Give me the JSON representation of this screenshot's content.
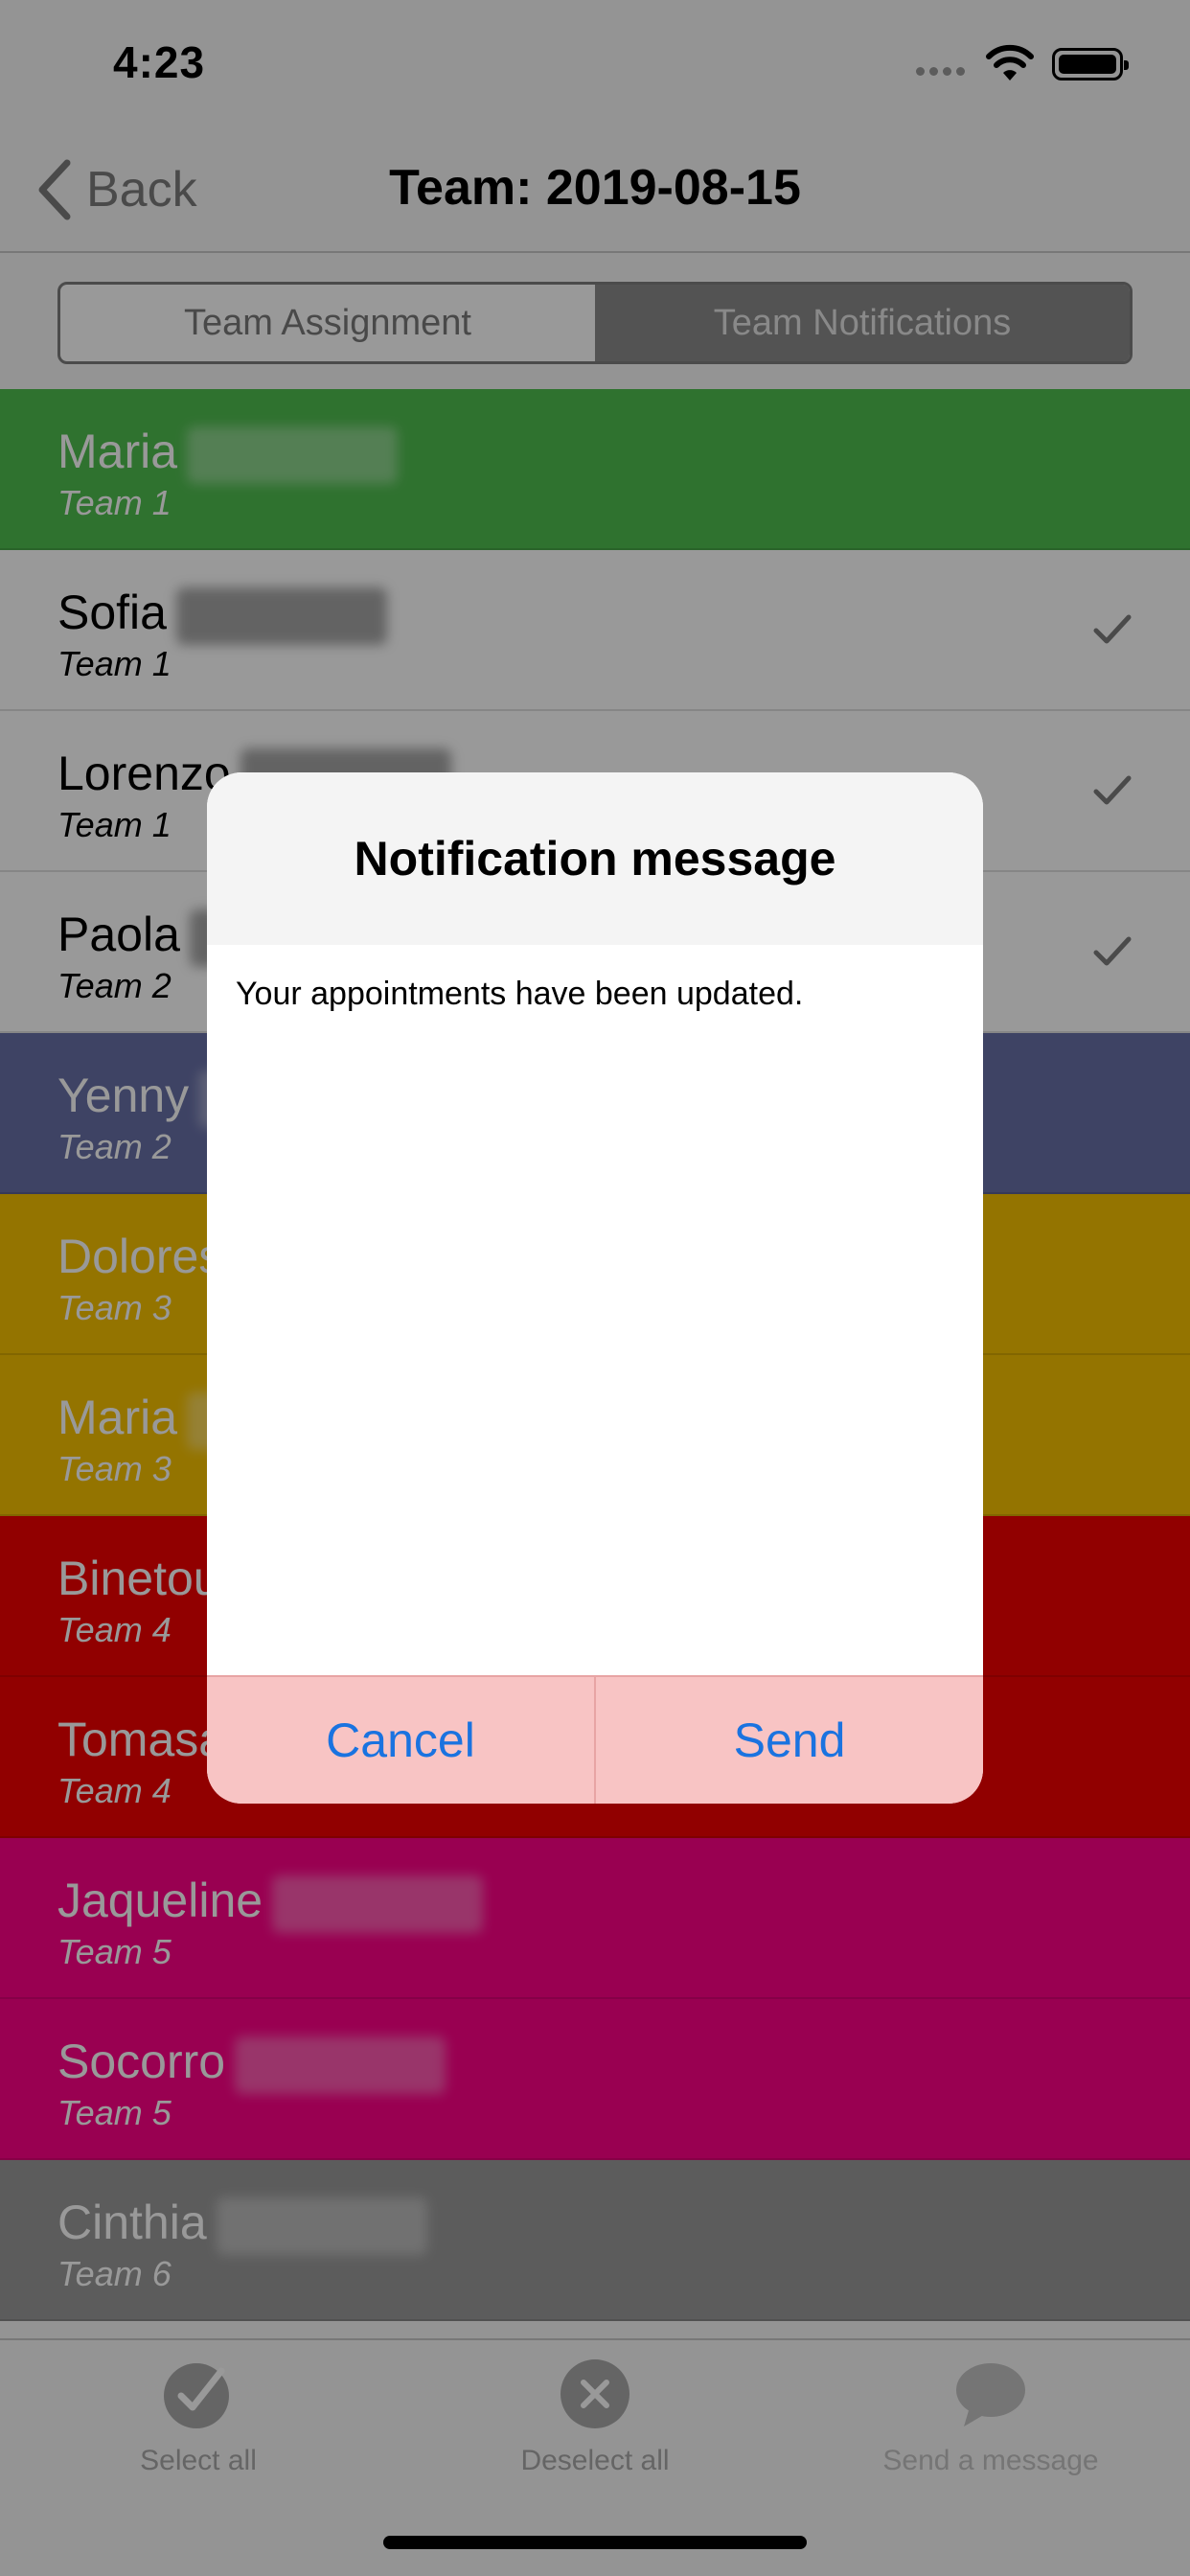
{
  "status": {
    "time": "4:23"
  },
  "nav": {
    "back_label": "Back",
    "title": "Team: 2019-08-15"
  },
  "segments": [
    {
      "label": "Team Assignment",
      "selected": false
    },
    {
      "label": "Team Notifications",
      "selected": true
    }
  ],
  "list": [
    {
      "name": "Maria",
      "team": "Team 1",
      "bg": "#4fbe4f",
      "fg": "#ffffff",
      "checked": false
    },
    {
      "name": "Sofia",
      "team": "Team 1",
      "bg": "#ffffff",
      "fg": "#000000",
      "checked": true
    },
    {
      "name": "Lorenzo",
      "team": "Team 1",
      "bg": "#ffffff",
      "fg": "#000000",
      "checked": true
    },
    {
      "name": "Paola",
      "team": "Team 2",
      "bg": "#ffffff",
      "fg": "#000000",
      "checked": true
    },
    {
      "name": "Yenny",
      "team": "Team 2",
      "bg": "#6870a7",
      "fg": "#ffffff",
      "checked": false
    },
    {
      "name": "Dolores",
      "team": "Team 3",
      "bg": "#f7c200",
      "fg": "#ffffff",
      "checked": false
    },
    {
      "name": "Maria",
      "team": "Team 3",
      "bg": "#f7c200",
      "fg": "#ffffff",
      "checked": false
    },
    {
      "name": "Binetou",
      "team": "Team 4",
      "bg": "#f20000",
      "fg": "#ffffff",
      "checked": false
    },
    {
      "name": "Tomasa",
      "team": "Team 4",
      "bg": "#f20000",
      "fg": "#ffffff",
      "checked": false
    },
    {
      "name": "Jaqueline",
      "team": "Team 5",
      "bg": "#ff0088",
      "fg": "#ffffff",
      "checked": false
    },
    {
      "name": "Socorro",
      "team": "Team 5",
      "bg": "#ff0088",
      "fg": "#ffffff",
      "checked": false
    },
    {
      "name": "Cinthia",
      "team": "Team 6",
      "bg": "#9a9a9a",
      "fg": "#ffffff",
      "checked": false
    }
  ],
  "tabbar": {
    "select_all": "Select all",
    "deselect_all": "Deselect all",
    "send_message": "Send a message"
  },
  "dialog": {
    "title": "Notification message",
    "message": "Your appointments have been updated.",
    "cancel_label": "Cancel",
    "send_label": "Send"
  }
}
